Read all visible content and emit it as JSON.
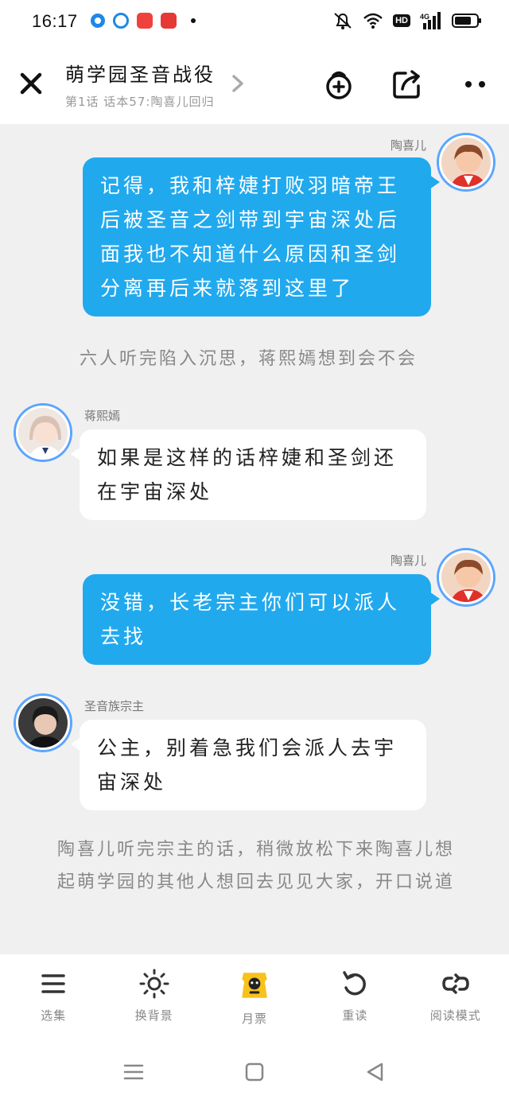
{
  "status_bar": {
    "time": "16:17",
    "notification_icons": [
      "qq-browser-icon",
      "browser-icon",
      "video-app-icon",
      "shopping-app-icon"
    ],
    "system_icons": [
      "alarm-off-icon",
      "wifi-icon",
      "hd-icon",
      "signal-4g-icon",
      "battery-icon"
    ],
    "hd_label": "HD"
  },
  "header": {
    "title": "萌学园圣音战役",
    "subtitle": "第1话 话本57:陶喜儿回归"
  },
  "chat": {
    "messages": [
      {
        "type": "right",
        "speaker": "陶喜儿",
        "text": "记得，我和梓婕打败羽暗帝王后被圣音之剑带到宇宙深处后面我也不知道什么原因和圣剑分离再后来就落到这里了"
      },
      {
        "type": "narration",
        "text": "六人听完陷入沉思，蒋熙嫣想到会不会"
      },
      {
        "type": "left",
        "speaker": "蒋熙嫣",
        "text": "如果是这样的话梓婕和圣剑还在宇宙深处"
      },
      {
        "type": "right",
        "speaker": "陶喜儿",
        "text": "没错，长老宗主你们可以派人去找"
      },
      {
        "type": "left",
        "speaker": "圣音族宗主",
        "text": "公主，别着急我们会派人去宇宙深处"
      },
      {
        "type": "narration",
        "text": "陶喜儿听完宗主的话，稍微放松下来陶喜儿想起萌学园的其他人想回去见见大家，开口说道"
      }
    ]
  },
  "toolbar": {
    "items": [
      {
        "label": "选集",
        "icon": "menu-icon"
      },
      {
        "label": "换背景",
        "icon": "brightness-icon"
      },
      {
        "label": "月票",
        "icon": "monthly-ticket-icon"
      },
      {
        "label": "重读",
        "icon": "reread-icon"
      },
      {
        "label": "阅读模式",
        "icon": "reading-mode-icon"
      }
    ]
  },
  "colors": {
    "bubble_blue": "#21a9ee",
    "background": "#f0f0f0",
    "avatar_ring": "#5aa5ff"
  }
}
